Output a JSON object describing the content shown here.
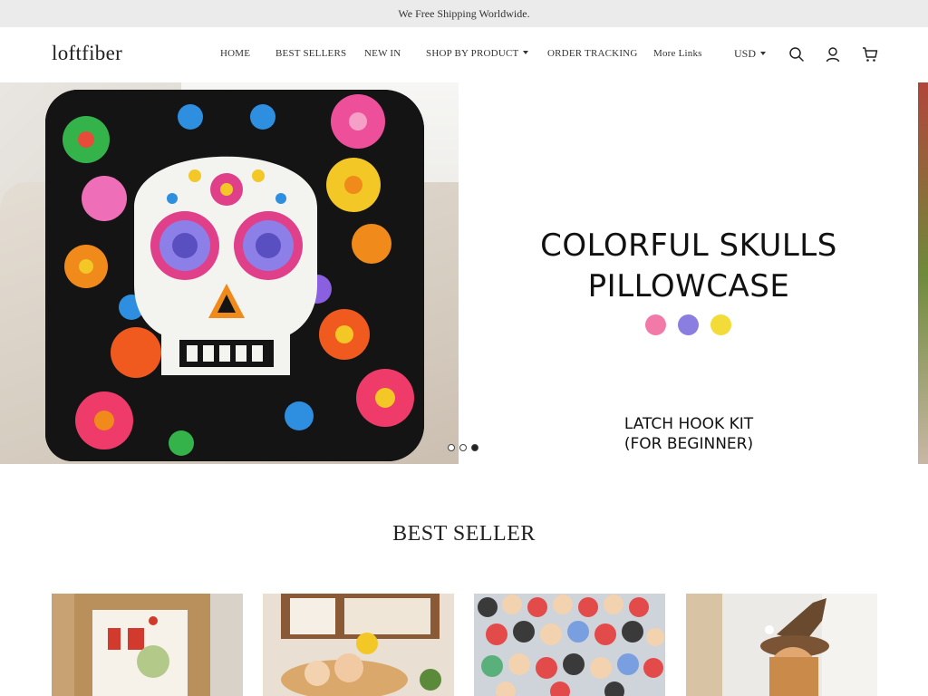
{
  "announcement": "We Free Shipping Worldwide.",
  "header": {
    "logo": "loftfiber",
    "nav": [
      {
        "label": "HOME"
      },
      {
        "label": "BEST SELLERS"
      },
      {
        "label": "NEW IN"
      },
      {
        "label": "SHOP BY PRODUCT"
      },
      {
        "label": "ORDER TRACKING"
      },
      {
        "label": "More Links"
      }
    ],
    "currency": "USD",
    "icons": [
      "search-icon",
      "account-icon",
      "cart-icon"
    ]
  },
  "hero": {
    "title_line1": "COLORFUL SKULLS",
    "title_line2": "PILLOWCASE",
    "subtitle_line1": "LATCH HOOK KIT",
    "subtitle_line2": "(FOR BEGINNER)",
    "color_dots": [
      "#f27aa8",
      "#8a7fe0",
      "#f4dc38"
    ],
    "slide_count": 3,
    "active_slide": 3
  },
  "best_seller": {
    "title": "BEST SELLER"
  },
  "colors": {
    "announce_bg": "#ebebeb",
    "text": "#222222"
  }
}
